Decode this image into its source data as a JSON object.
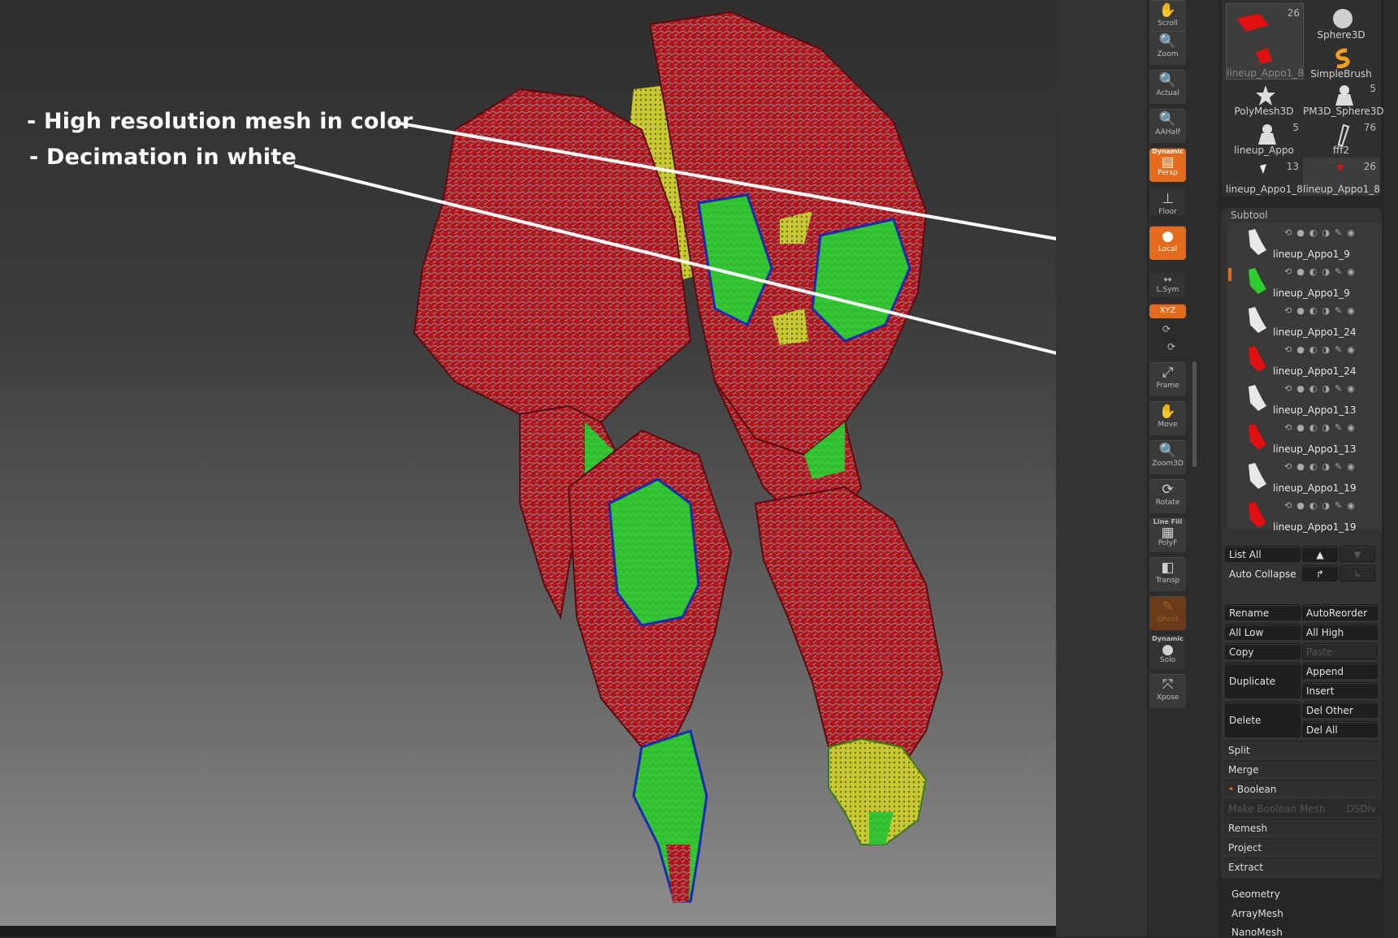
{
  "annotations": {
    "line1": "- High resolution mesh in color",
    "line2": "- Decimation in white"
  },
  "shelf": {
    "scroll": "Scroll",
    "zoom": "Zoom",
    "actual": "Actual",
    "aahalf": "AAHalf",
    "dynamic_label": "Dynamic",
    "persp": "Persp",
    "floor": "Floor",
    "local": "Local",
    "lsym": "L.Sym",
    "xyz": "XYZ",
    "frame": "Frame",
    "move": "Move",
    "zoom3d": "Zoom3D",
    "rotate": "Rotate",
    "line_fill": "Line Fill",
    "polyf": "PolyF",
    "transp": "Transp",
    "ghost": "Ghost",
    "dynamic2": "Dynamic",
    "solo": "Solo",
    "xpose": "Xpose"
  },
  "tool_thumbs": [
    {
      "label": "lineup_Appo1_8",
      "count": "26"
    },
    {
      "label": "Sphere3D",
      "count": ""
    },
    {
      "label": "",
      "count": ""
    },
    {
      "label": "SimpleBrush",
      "count": ""
    },
    {
      "label": "PolyMesh3D",
      "count": ""
    },
    {
      "label": "PM3D_Sphere3D",
      "count": "5"
    },
    {
      "label": "lineup_Appo",
      "count": "5"
    },
    {
      "label": "fff2",
      "count": "76"
    },
    {
      "label": "lineup_Appo1_8",
      "count": "13"
    },
    {
      "label": "lineup_Appo1_8",
      "count": "26"
    }
  ],
  "subtool": {
    "title": "Subtool",
    "items": [
      {
        "name": "lineup_Appo1_9",
        "color": "#e8e8e8"
      },
      {
        "name": "lineup_Appo1_9",
        "color": "#2ecc2e"
      },
      {
        "name": "lineup_Appo1_24",
        "color": "#e8e8e8"
      },
      {
        "name": "lineup_Appo1_24",
        "color": "#e01010"
      },
      {
        "name": "lineup_Appo1_13",
        "color": "#e8e8e8"
      },
      {
        "name": "lineup_Appo1_13",
        "color": "#e01010"
      },
      {
        "name": "lineup_Appo1_19",
        "color": "#e8e8e8"
      },
      {
        "name": "lineup_Appo1_19",
        "color": "#e01010"
      }
    ]
  },
  "buttons": {
    "list_all": "List All",
    "auto_collapse": "Auto Collapse",
    "rename": "Rename",
    "auto_reorder": "AutoReorder",
    "all_low": "All Low",
    "all_high": "All High",
    "copy": "Copy",
    "paste": "Paste",
    "duplicate": "Duplicate",
    "append": "Append",
    "insert": "Insert",
    "delete": "Delete",
    "del_other": "Del Other",
    "del_all": "Del All"
  },
  "sections": {
    "split": "Split",
    "merge": "Merge",
    "boolean": "Boolean",
    "make_boolean_mesh": "Make Boolean Mesh",
    "dsdiv": "DSDiv",
    "remesh": "Remesh",
    "project": "Project",
    "extract": "Extract"
  },
  "bottom": {
    "geometry": "Geometry",
    "arraymesh": "ArrayMesh",
    "nanomesh": "NanoMesh"
  },
  "colors": {
    "accent": "#e46a1c",
    "mesh_red": "#b5121b",
    "mesh_green": "#2fbf2f",
    "mesh_yellow": "#c8c832"
  }
}
